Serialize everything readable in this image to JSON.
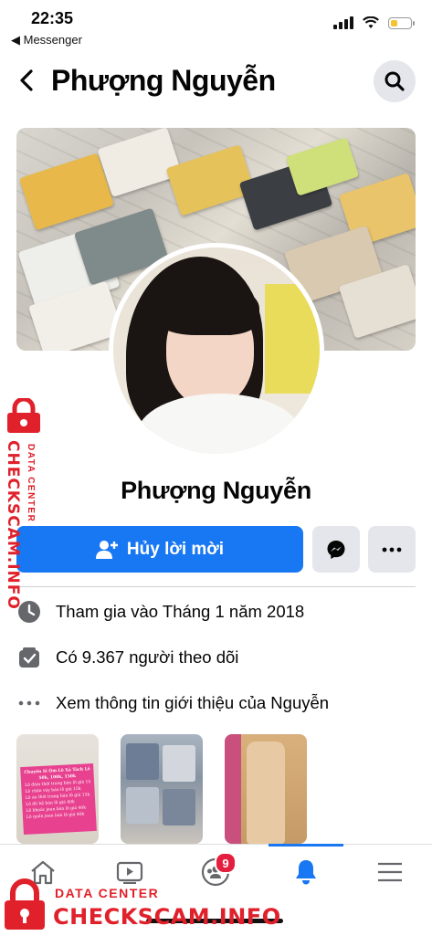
{
  "status_bar": {
    "time": "22:35",
    "back_app": "◀ Messenger",
    "battery_level": 0.35
  },
  "header": {
    "title": "Phượng Nguyễn"
  },
  "profile": {
    "name": "Phượng Nguyễn",
    "primary_action": "Hủy lời mời"
  },
  "info": {
    "joined": "Tham gia vào Tháng 1 năm 2018",
    "followers": "Có 9.367 người theo dõi",
    "about": "Xem thông tin giới thiệu của Nguyễn"
  },
  "photos": {
    "pink_card_lines": [
      "Chuyên Sỉ Ôm Lô Xả Tách Lô",
      "50k, 100k, 150k",
      "Lô đầm thời trang bán lô giá 15k",
      "Lô chân váy bán lô giá 15k",
      "Lô áo thời trang bán lô giá 15k",
      "Lô đồ bộ bán lô giá 40k",
      "Lô khoác jean bán lô giá 40k",
      "Lô quần jean bán lô giá 40k"
    ]
  },
  "tabbar": {
    "groups_badge": "9",
    "active_tab": "notifications"
  },
  "watermark": {
    "line1": "DATA CENTER",
    "line2": "CHECKSCAM.INFO"
  },
  "colors": {
    "primary": "#1877f2",
    "badge": "#e41e3f",
    "watermark": "#e0202a",
    "button_gray": "#e4e6eb"
  }
}
